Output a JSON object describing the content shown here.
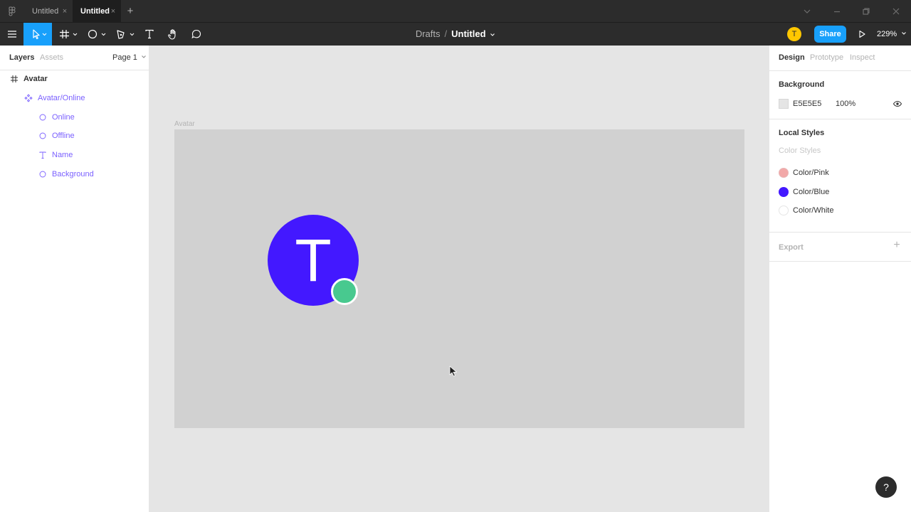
{
  "titlebar": {
    "tabs": [
      {
        "label": "Untitled",
        "active": false
      },
      {
        "label": "Untitled",
        "active": true
      }
    ],
    "tab_close_glyph": "×",
    "add_tab_glyph": "+"
  },
  "toolbar": {
    "breadcrumb_parent": "Drafts",
    "breadcrumb_separator": "/",
    "breadcrumb_current": "Untitled",
    "user_initial": "T",
    "share_label": "Share",
    "zoom_label": "229%"
  },
  "left_panel": {
    "tabs": [
      "Layers",
      "Assets"
    ],
    "page_selector": "Page 1",
    "layers": [
      {
        "label": "Avatar",
        "kind": "frame"
      },
      {
        "label": "Avatar/Online",
        "kind": "component"
      },
      {
        "label": "Online",
        "kind": "ellipse"
      },
      {
        "label": "Offline",
        "kind": "ellipse"
      },
      {
        "label": "Name",
        "kind": "text"
      },
      {
        "label": "Background",
        "kind": "ellipse"
      }
    ]
  },
  "canvas": {
    "frame_label": "Avatar",
    "avatar_letter": "T",
    "frame_color": "#d1d1d1",
    "avatar_color": "#4318ff",
    "status_color": "#48c98f"
  },
  "right_panel": {
    "tabs": [
      "Design",
      "Prototype",
      "Inspect"
    ],
    "background_title": "Background",
    "background_hex": "E5E5E5",
    "background_opacity": "100%",
    "local_styles_title": "Local Styles",
    "color_styles_label": "Color Styles",
    "color_styles": [
      {
        "name": "Color/Pink",
        "color": "#f2a8a8"
      },
      {
        "name": "Color/Blue",
        "color": "#4318ff"
      },
      {
        "name": "Color/White",
        "color": "#ffffff"
      }
    ],
    "export_title": "Export",
    "export_add_glyph": "+"
  },
  "help_label": "?"
}
